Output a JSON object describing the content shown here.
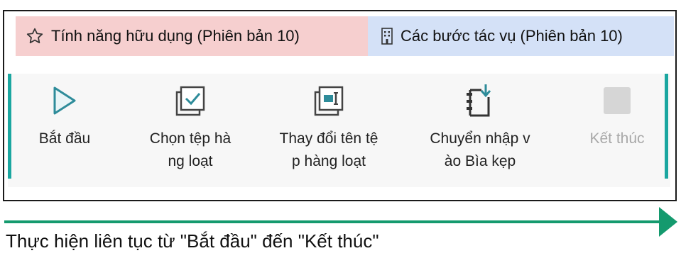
{
  "tabs": [
    {
      "label": "Tính năng hữu dụng (Phiên bản 10)",
      "icon": "star-outline-icon",
      "color": "#f6cfcf"
    },
    {
      "label": "Các bước tác vụ (Phiên bản 10)",
      "icon": "building-icon",
      "color": "#d4e1f7"
    }
  ],
  "commands": {
    "start": {
      "label": "Bắt đầu",
      "icon": "play-icon"
    },
    "batch_select": {
      "line1": "Chọn tệp hà",
      "line2": "ng loạt",
      "icon": "checkbox-stack-icon"
    },
    "batch_rename": {
      "line1": "Thay đổi tên tệ",
      "line2": "p hàng loạt",
      "icon": "rename-stack-icon"
    },
    "import_binder": {
      "line1": "Chuyển nhập v",
      "line2": "ào Bìa kẹp",
      "icon": "binder-import-icon"
    },
    "end": {
      "label": "Kết thúc",
      "icon": "stop-icon",
      "disabled": true
    }
  },
  "accent_color": "#1aa6a0",
  "arrow_color": "#149a6e",
  "caption": "Thực hiện liên tục từ \"Bắt đầu\" đến \"Kết thúc\""
}
